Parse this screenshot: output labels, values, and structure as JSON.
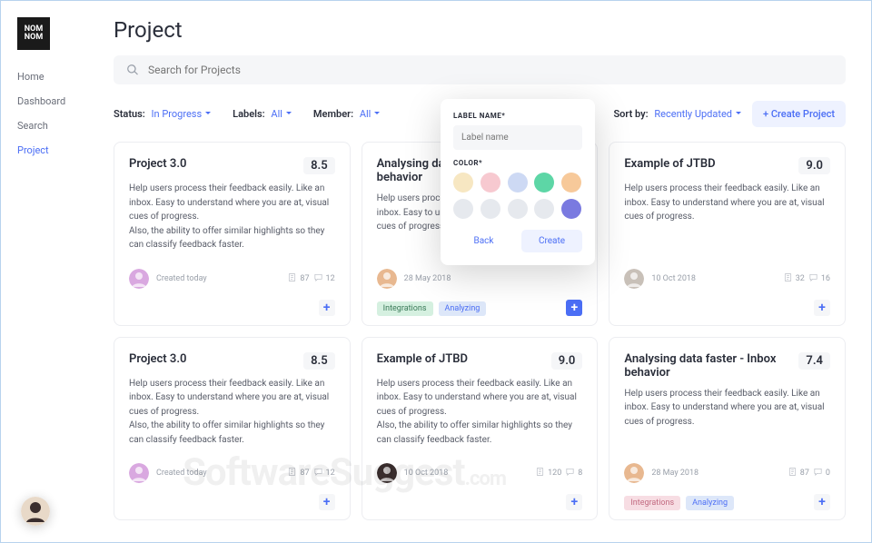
{
  "brand": {
    "line1": "NOM",
    "line2": "NOM"
  },
  "nav": {
    "items": [
      "Home",
      "Dashboard",
      "Search",
      "Project"
    ],
    "active": "Project"
  },
  "page": {
    "title": "Project"
  },
  "search": {
    "placeholder": "Search for Projects"
  },
  "filters": {
    "status_label": "Status:",
    "status_value": "In Progress",
    "labels_label": "Labels:",
    "labels_value": "All",
    "member_label": "Member:",
    "member_value": "All",
    "sort_label": "Sort by:",
    "sort_value": "Recently Updated"
  },
  "create_btn": "+ Create Project",
  "cards": [
    {
      "title": "Project 3.0",
      "score": "8.5",
      "body1": "Help users process their feedback easily. Like an inbox. Easy to understand where you are at, visual cues of progress.",
      "body2": "Also, the ability to offer similar highlights so they can classify feedback faster.",
      "date": "Created today",
      "docs": "87",
      "comments": "12",
      "avatar_bg": "#d9a8e0",
      "tags": [],
      "add_primary": false
    },
    {
      "title": "Analysing data faster - Inbox behavior",
      "score": "",
      "body1": "Help users process their feedback easily. Like an inbox. Easy to understand where you are at, visual cues of progress.",
      "body2": "",
      "date": "28 May 2018",
      "docs": "",
      "comments": "",
      "avatar_bg": "#e8b890",
      "tags": [
        {
          "text": "Integrations",
          "cls": "green"
        },
        {
          "text": "Analyzing",
          "cls": "blue"
        }
      ],
      "add_primary": true
    },
    {
      "title": "Example of JTBD",
      "score": "9.0",
      "body1": "Help users process their feedback easily. Like an inbox. Easy to understand where you are at, visual cues of progress.",
      "body2": "",
      "date": "10 Oct 2018",
      "docs": "32",
      "comments": "16",
      "avatar_bg": "#c8c0b8",
      "tags": [],
      "add_primary": false
    },
    {
      "title": "Project 3.0",
      "score": "8.5",
      "body1": "Help users process their feedback easily. Like an inbox. Easy to understand where you are at, visual cues of progress.",
      "body2": "Also, the ability to offer similar highlights so they can classify feedback faster.",
      "date": "Created today",
      "docs": "87",
      "comments": "12",
      "avatar_bg": "#d9a8e0",
      "tags": [],
      "add_primary": false
    },
    {
      "title": "Example of JTBD",
      "score": "9.0",
      "body1": "Help users process their feedback easily. Like an inbox. Easy to understand where you are at, visual cues of progress.",
      "body2": "Also, the ability to offer similar highlights so they can classify feedback faster.",
      "date": "10 Oct 2018",
      "docs": "120",
      "comments": "8",
      "avatar_bg": "#3a2e2e",
      "tags": [],
      "add_primary": false
    },
    {
      "title": "Analysing data faster - Inbox behavior",
      "score": "7.4",
      "body1": "Help users process their feedback easily. Like an inbox. Easy to understand where you are at, visual cues of progress.",
      "body2": "",
      "date": "28 May 2018",
      "docs": "87",
      "comments": "0",
      "avatar_bg": "#e8b890",
      "tags": [
        {
          "text": "Integrations",
          "cls": "pink"
        },
        {
          "text": "Analyzing",
          "cls": "blue"
        }
      ],
      "add_primary": false
    }
  ],
  "popover": {
    "label_name_title": "LABEL NAME*",
    "placeholder": "Label name",
    "color_title": "COLOR*",
    "swatches": [
      "#f7e7c2",
      "#f7c9d0",
      "#cdd9f4",
      "#5dd6a6",
      "#f7c99a",
      "#e6e9ee",
      "#e6e9ee",
      "#e6e9ee",
      "#e6e9ee",
      "#7a7ae0"
    ],
    "back": "Back",
    "create": "Create"
  },
  "watermark": {
    "main": "SoftwareSuggest",
    "suffix": ".com"
  }
}
